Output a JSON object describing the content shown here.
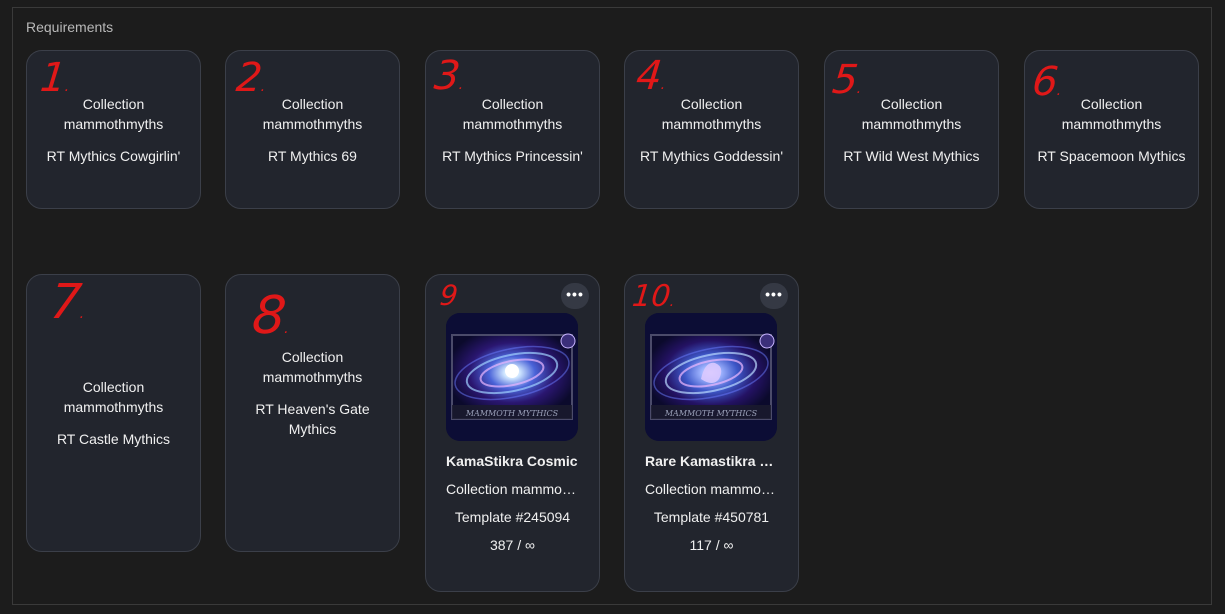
{
  "section": {
    "title": "Requirements"
  },
  "cards": [
    {
      "annotation": "1",
      "collection": "Collection mammothmyths",
      "schema": "RT Mythics Cowgirlin'"
    },
    {
      "annotation": "2",
      "collection": "Collection mammothmyths",
      "schema": "RT Mythics 69"
    },
    {
      "annotation": "3",
      "collection": "Collection mammothmyths",
      "schema": "RT Mythics Princessin'"
    },
    {
      "annotation": "4",
      "collection": "Collection mammothmyths",
      "schema": "RT Mythics Goddessin'"
    },
    {
      "annotation": "5",
      "collection": "Collection mammothmyths",
      "schema": "RT Wild West Mythics"
    },
    {
      "annotation": "6",
      "collection": "Collection mammothmyths",
      "schema": "RT Spacemoon Mythics"
    },
    {
      "annotation": "7",
      "collection": "Collection mammothmyths",
      "schema": "RT Castle Mythics"
    },
    {
      "annotation": "8",
      "collection": "Collection mammothmyths",
      "schema": "RT Heaven's Gate Mythics"
    }
  ],
  "nfts": [
    {
      "annotation": "9",
      "more": "•••",
      "name": "KamaStikra Cosmic",
      "collection": "Collection mammothmyths",
      "template": "Template #245094",
      "mint": "387 / ∞",
      "image_text": "MAMMOTH MYTHICS",
      "icon": "badge-icon"
    },
    {
      "annotation": "10",
      "more": "•••",
      "name": "Rare Kamastikra Cosmic",
      "collection": "Collection mammothmyths",
      "template": "Template #450781",
      "mint": "117 / ∞",
      "image_text": "MAMMOTH MYTHICS",
      "icon": "badge-icon"
    }
  ],
  "colors": {
    "annotation": "#e01818",
    "card_bg": "#22252d",
    "page_bg": "#1c1c1c"
  }
}
